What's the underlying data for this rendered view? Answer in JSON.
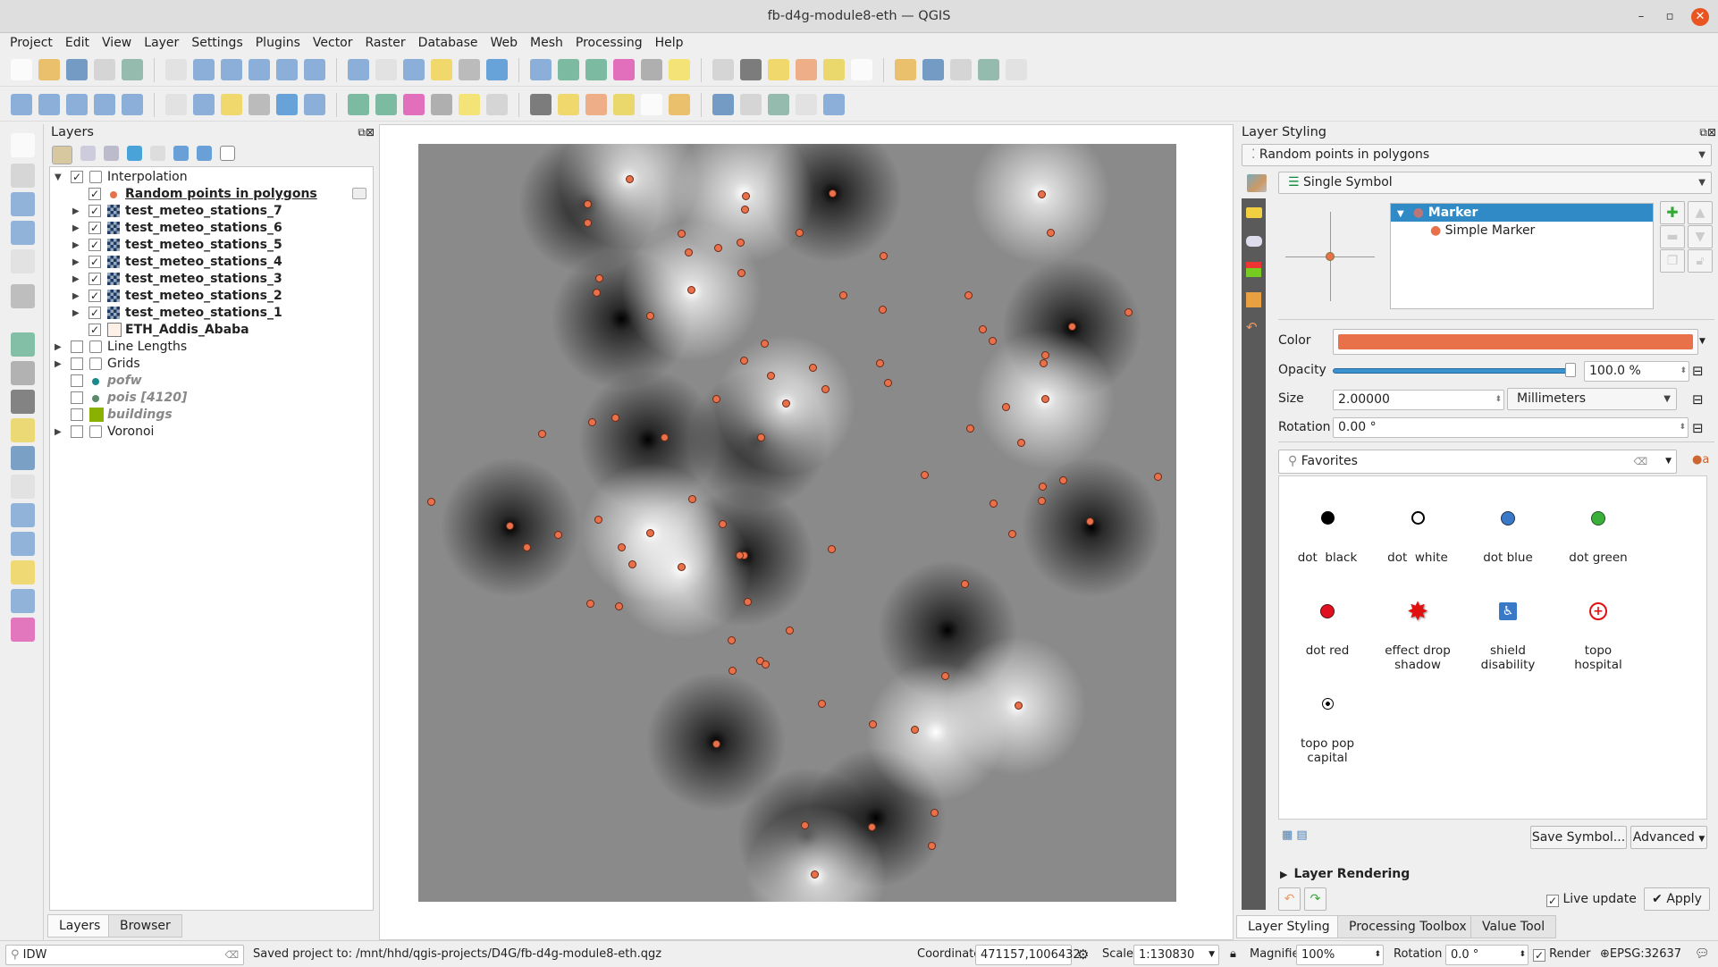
{
  "window": {
    "title": "fb-d4g-module8-eth — QGIS"
  },
  "menu": [
    "Project",
    "Edit",
    "View",
    "Layer",
    "Settings",
    "Plugins",
    "Vector",
    "Raster",
    "Database",
    "Web",
    "Mesh",
    "Processing",
    "Help"
  ],
  "layers_panel": {
    "title": "Layers",
    "tabs": [
      "Layers",
      "Browser"
    ],
    "items": [
      {
        "label": "Interpolation",
        "checked": true,
        "type": "group"
      },
      {
        "label": "Random points in polygons",
        "checked": true,
        "type": "point"
      },
      {
        "label": "test_meteo_stations_7",
        "checked": true,
        "type": "raster"
      },
      {
        "label": "test_meteo_stations_6",
        "checked": true,
        "type": "raster"
      },
      {
        "label": "test_meteo_stations_5",
        "checked": true,
        "type": "raster"
      },
      {
        "label": "test_meteo_stations_4",
        "checked": true,
        "type": "raster"
      },
      {
        "label": "test_meteo_stations_3",
        "checked": true,
        "type": "raster"
      },
      {
        "label": "test_meteo_stations_2",
        "checked": true,
        "type": "raster"
      },
      {
        "label": "test_meteo_stations_1",
        "checked": true,
        "type": "raster"
      },
      {
        "label": "ETH_Addis_Ababa",
        "checked": true,
        "type": "polygon"
      },
      {
        "label": "Line Lengths",
        "checked": false,
        "type": "group"
      },
      {
        "label": "Grids",
        "checked": false,
        "type": "group"
      },
      {
        "label": "pofw",
        "checked": false,
        "type": "point"
      },
      {
        "label": "pois [4120]",
        "checked": false,
        "type": "point"
      },
      {
        "label": "buildings",
        "checked": false,
        "type": "polygon"
      },
      {
        "label": "Voronoi",
        "checked": false,
        "type": "group"
      }
    ]
  },
  "styling": {
    "title": "Layer Styling",
    "layer": "Random points in polygons",
    "renderer": "Single Symbol",
    "tree": {
      "root": "Marker",
      "child": "Simple Marker"
    },
    "color_label": "Color",
    "color": "#e8714a",
    "opacity_label": "Opacity",
    "opacity": "100.0 %",
    "opacity_value": 1.0,
    "size_label": "Size",
    "size": "2.00000",
    "unit": "Millimeters",
    "rotation_label": "Rotation",
    "rotation": "0.00 °",
    "search": "Favorites",
    "symbols": [
      "dot  black",
      "dot  white",
      "dot blue",
      "dot green",
      "dot red",
      "effect drop shadow",
      "shield disability",
      "topo hospital",
      "topo pop capital"
    ],
    "save_symbol": "Save Symbol...",
    "advanced": "Advanced",
    "layer_rendering": "Layer Rendering",
    "live_update": "Live update",
    "apply": "Apply",
    "tabs": [
      "Layer Styling",
      "Processing Toolbox",
      "Value Tool"
    ]
  },
  "statusbar": {
    "search": "IDW",
    "message": "Saved project to: /mnt/hhd/qgis-projects/D4G/fb-d4g-module8-eth.qgz",
    "coordinate_label": "Coordinate",
    "coordinate": "471157,1006432",
    "scale_label": "Scale",
    "scale": "1:130830",
    "magnifier_label": "Magnifier",
    "magnifier": "100%",
    "rotation_label": "Rotation",
    "rotation": "0.0 °",
    "render_label": "Render",
    "crs": "EPSG:32637"
  }
}
